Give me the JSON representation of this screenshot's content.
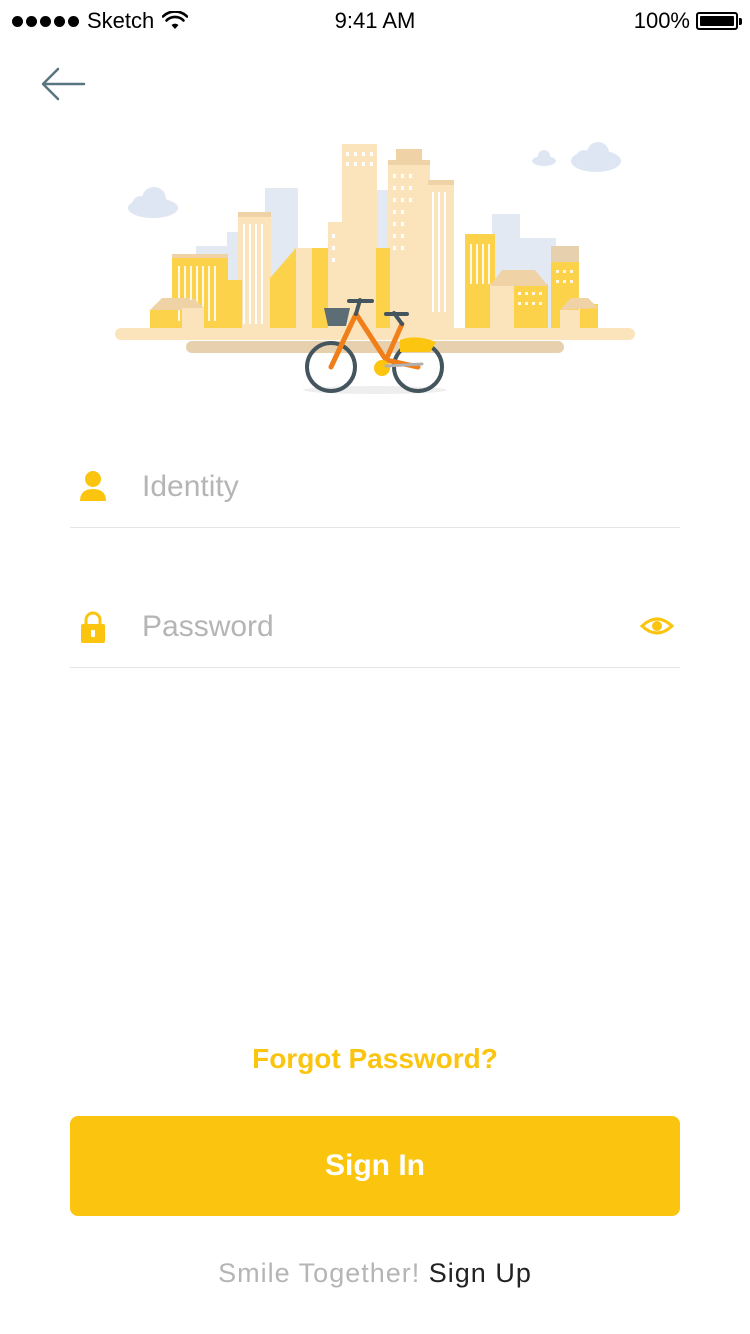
{
  "status_bar": {
    "carrier": "Sketch",
    "time": "9:41 AM",
    "battery": "100%"
  },
  "form": {
    "identity_placeholder": "Identity",
    "identity_value": "",
    "password_placeholder": "Password",
    "password_value": ""
  },
  "actions": {
    "forgot_password": "Forgot Password?",
    "sign_in": "Sign In"
  },
  "footer": {
    "tagline": "Smile Together!",
    "sign_up": "Sign Up"
  },
  "colors": {
    "accent": "#fbc40e",
    "placeholder": "#b5b5b5",
    "divider": "#e5e5e5",
    "back_arrow": "#5a7582"
  },
  "icons": {
    "back": "arrow-left-icon",
    "identity": "user-icon",
    "password": "lock-icon",
    "password_toggle": "eye-icon",
    "signal": "signal-dots-icon",
    "wifi": "wifi-icon",
    "battery": "battery-icon"
  }
}
